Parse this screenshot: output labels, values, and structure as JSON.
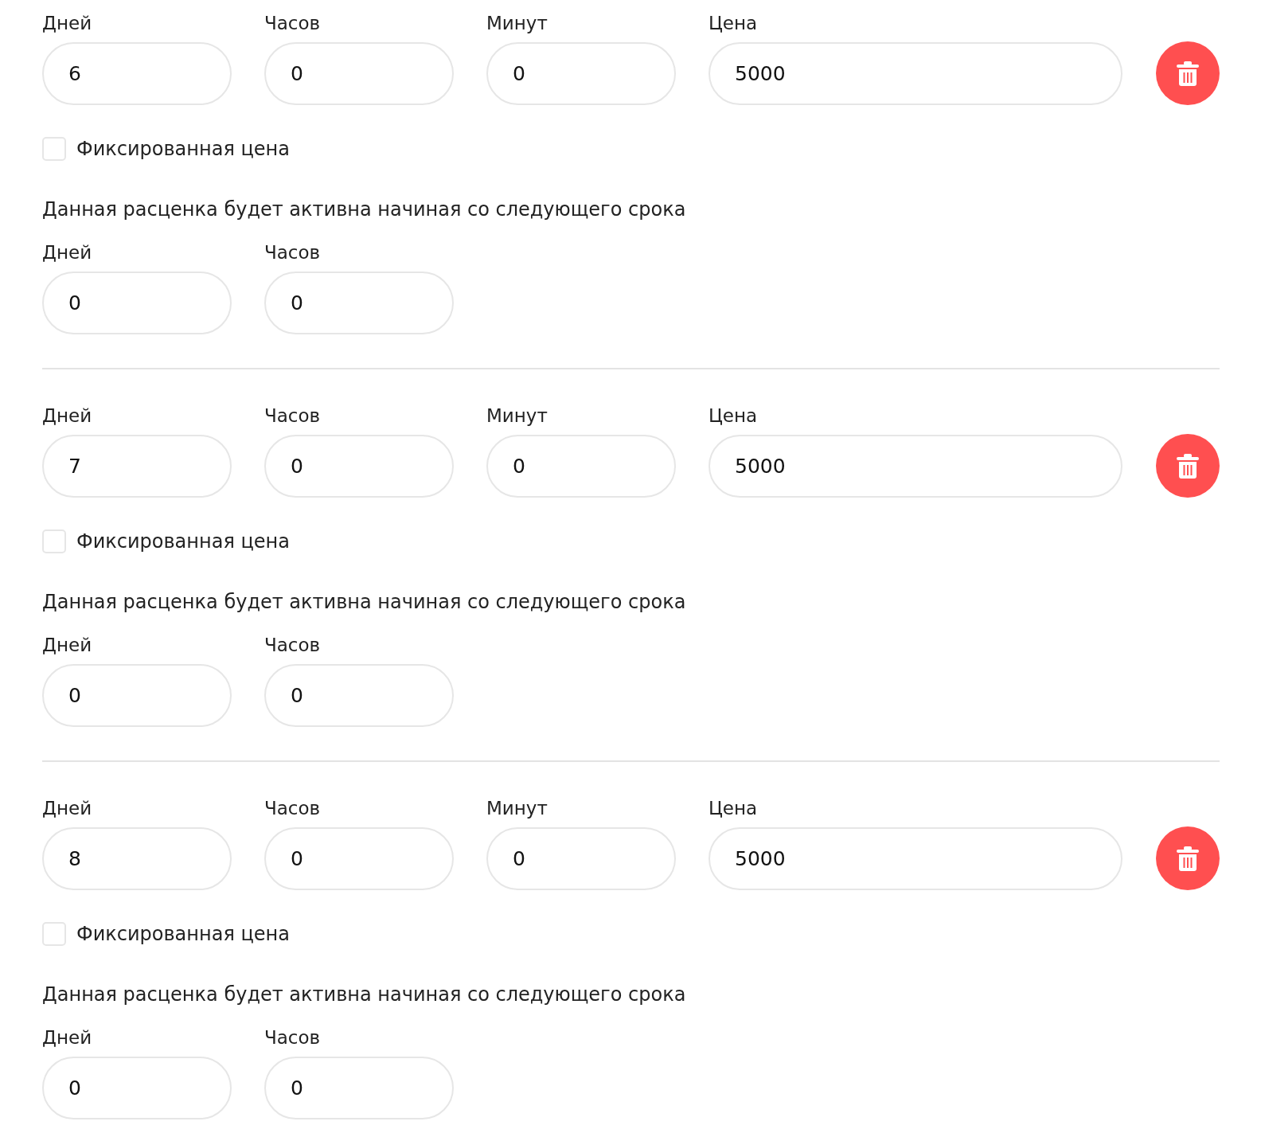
{
  "rates": [
    {
      "fields": [
        {
          "label": "Дней",
          "value": "6"
        },
        {
          "label": "Часов",
          "value": "0"
        },
        {
          "label": "Минут",
          "value": "0"
        },
        {
          "label": "Цена",
          "value": "5000"
        }
      ],
      "fixed_price": {
        "label": "Фиксированная цена",
        "checked": false
      },
      "note": "Данная расценка будет активна начиная со следующего срока",
      "start_fields": [
        {
          "label": "Дней",
          "value": "0"
        },
        {
          "label": "Часов",
          "value": "0"
        }
      ]
    },
    {
      "fields": [
        {
          "label": "Дней",
          "value": "7"
        },
        {
          "label": "Часов",
          "value": "0"
        },
        {
          "label": "Минут",
          "value": "0"
        },
        {
          "label": "Цена",
          "value": "5000"
        }
      ],
      "fixed_price": {
        "label": "Фиксированная цена",
        "checked": false
      },
      "note": "Данная расценка будет активна начиная со следующего срока",
      "start_fields": [
        {
          "label": "Дней",
          "value": "0"
        },
        {
          "label": "Часов",
          "value": "0"
        }
      ]
    },
    {
      "fields": [
        {
          "label": "Дней",
          "value": "8"
        },
        {
          "label": "Часов",
          "value": "0"
        },
        {
          "label": "Минут",
          "value": "0"
        },
        {
          "label": "Цена",
          "value": "5000"
        }
      ],
      "fixed_price": {
        "label": "Фиксированная цена",
        "checked": false
      },
      "note": "Данная расценка будет активна начиная со следующего срока",
      "start_fields": [
        {
          "label": "Дней",
          "value": "0"
        },
        {
          "label": "Часов",
          "value": "0"
        }
      ]
    }
  ]
}
